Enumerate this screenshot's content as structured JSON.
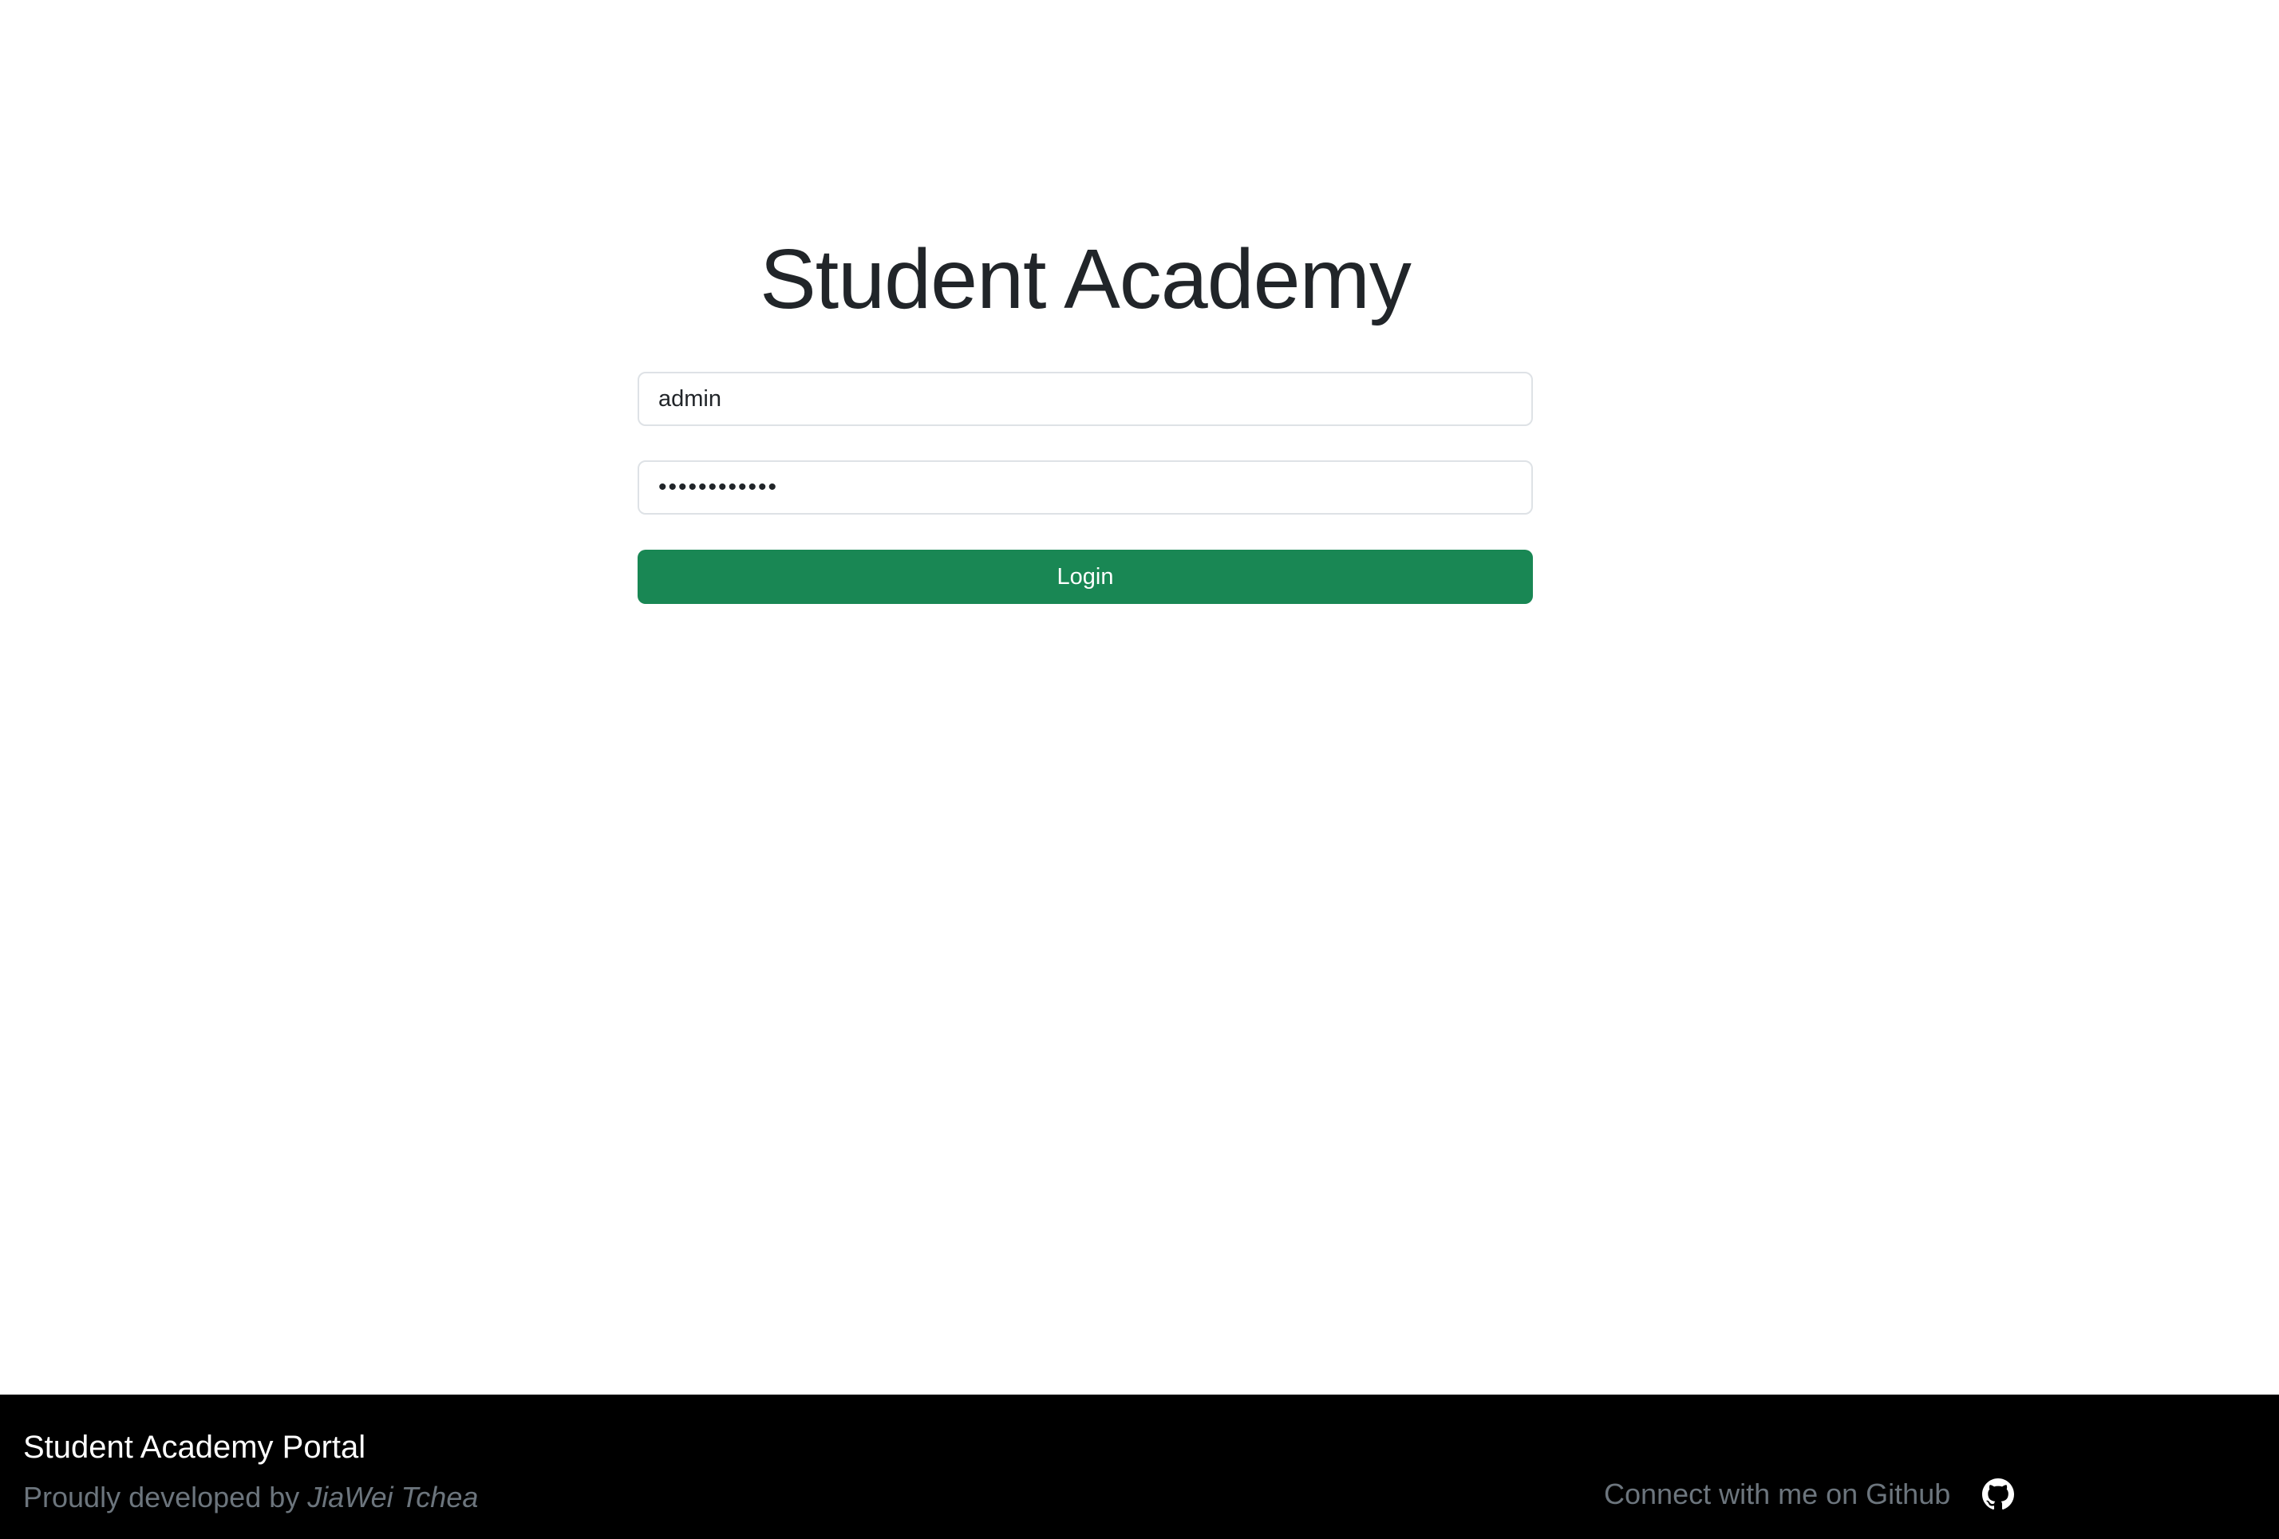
{
  "login": {
    "title": "Student Academy",
    "username_value": "admin",
    "password_value": "••••••••••••",
    "login_button": "Login"
  },
  "footer": {
    "title": "Student Academy Portal",
    "credit_prefix": "Proudly developed by ",
    "credit_author": "JiaWei Tchea",
    "github_text": "Connect with me on Github",
    "github_icon": "github-icon"
  },
  "colors": {
    "accent_green": "#198754",
    "footer_bg": "#000000",
    "muted_text": "#6c757d"
  }
}
